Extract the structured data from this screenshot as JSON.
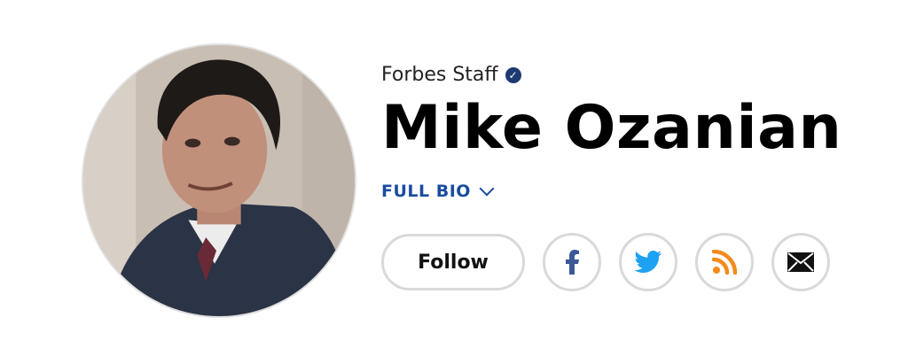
{
  "profile": {
    "staff_label": "Forbes Staff",
    "name": "Mike Ozanian",
    "full_bio_label": "FULL BIO",
    "follow_label": "Follow"
  },
  "social": {
    "facebook_icon": "facebook-icon",
    "twitter_icon": "twitter-icon",
    "rss_icon": "rss-icon",
    "email_icon": "email-icon"
  },
  "colors": {
    "facebook": "#3b5998",
    "twitter": "#1da1f2",
    "rss": "#f48a1b",
    "email": "#111111",
    "bio_link": "#1a4ca0",
    "verified_badge": "#1e3a73"
  }
}
